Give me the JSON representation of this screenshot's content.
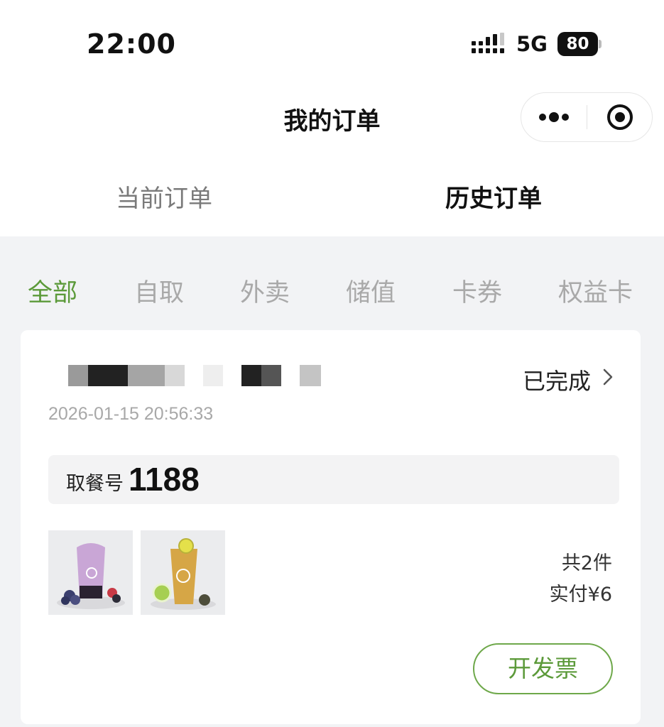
{
  "status_bar": {
    "time": "22:00",
    "network": "5G",
    "battery": "80"
  },
  "nav": {
    "title": "我的订单",
    "more_icon": "more-dots-icon",
    "close_icon": "target-close-icon"
  },
  "tabs": [
    {
      "label": "当前订单",
      "active": false
    },
    {
      "label": "历史订单",
      "active": true
    }
  ],
  "filters": [
    {
      "label": "全部",
      "active": true
    },
    {
      "label": "自取",
      "active": false
    },
    {
      "label": "外卖",
      "active": false
    },
    {
      "label": "储值",
      "active": false
    },
    {
      "label": "卡券",
      "active": false
    },
    {
      "label": "权益卡",
      "active": false
    }
  ],
  "order": {
    "status": "已完成",
    "datetime": "2026-01-15 20:56:33",
    "pickup_label": "取餐号",
    "pickup_number": "1188",
    "item_count": "共2件",
    "paid": "实付¥6",
    "invoice_button": "开发票",
    "items": [
      {
        "icon": "purple-drink-image"
      },
      {
        "icon": "lemon-tea-image"
      }
    ]
  },
  "colors": {
    "accent": "#5c9a3a",
    "background": "#f2f3f5"
  }
}
